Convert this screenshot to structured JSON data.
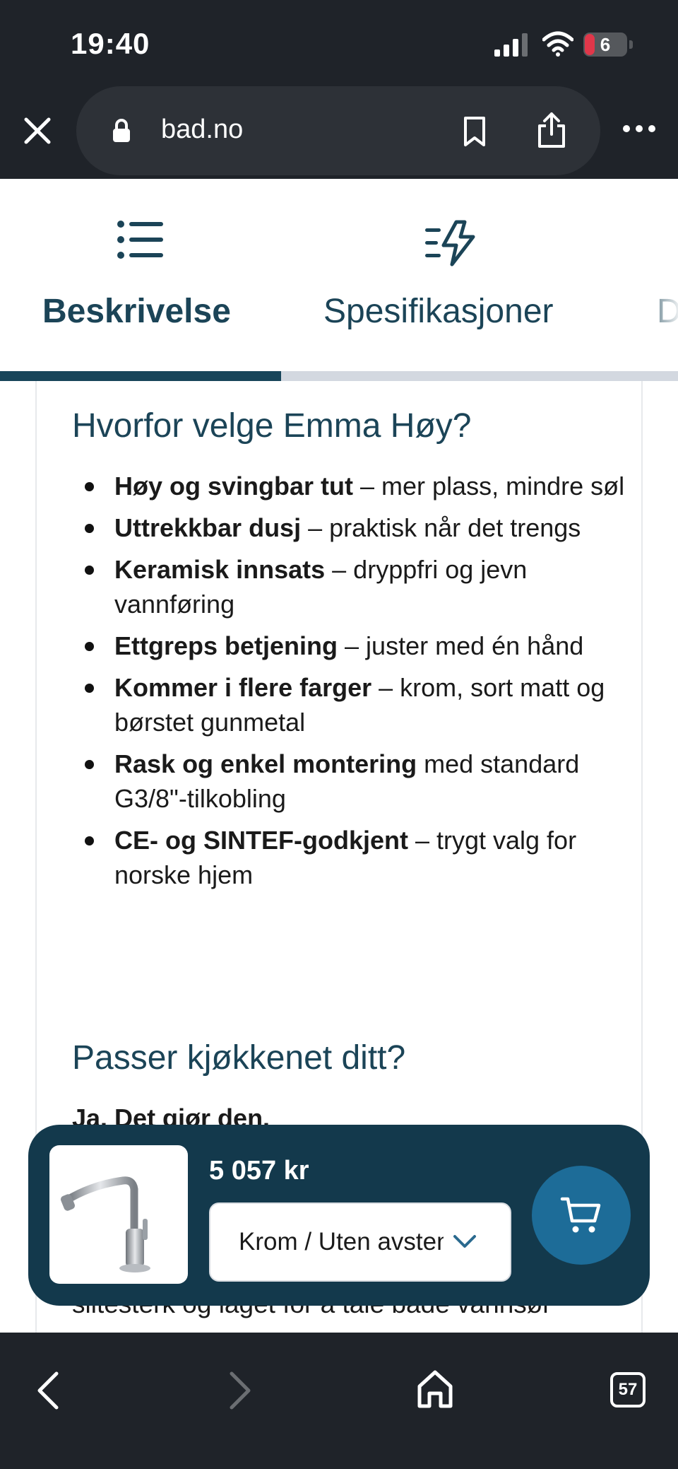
{
  "status_bar": {
    "time": "19:40",
    "battery": "6"
  },
  "browser": {
    "url": "bad.no"
  },
  "tabs": [
    {
      "label": "Beskrivelse",
      "icon": "list-icon",
      "active": true
    },
    {
      "label": "Spesifikasjoner",
      "icon": "lightning-lines-icon",
      "active": false
    },
    {
      "label": "D",
      "active": false
    }
  ],
  "content": {
    "why_heading": "Hvorfor velge Emma Høy?",
    "features": [
      {
        "bold": "Høy og svingbar tut",
        "text": " – mer plass, mindre søl"
      },
      {
        "bold": "Uttrekkbar dusj",
        "text": " – praktisk når det trengs"
      },
      {
        "bold": "Keramisk innsats",
        "text": " – dryppfri og jevn vannføring"
      },
      {
        "bold": "Ettgreps betjening",
        "text": " – juster med én hånd"
      },
      {
        "bold": "Kommer i flere farger",
        "text": " – krom, sort matt og børstet gunmetal"
      },
      {
        "bold": "Rask og enkel montering",
        "text": " med standard G3/8\"-tilkobling"
      },
      {
        "bold": "CE- og SINTEF-godkjent",
        "text": " – trygt valg for norske hjem"
      }
    ],
    "fit_heading": "Passer kjøkkenet ditt?",
    "fit_answer": "Ja. Det gjør den.",
    "body_line": "slitesterk og laget for å tåle både vannsøl"
  },
  "buy_bar": {
    "price": "5 057 kr",
    "variant": "Krom / Uten avstengning",
    "product_image": "kitchen-faucet-chrome"
  },
  "bottom_bar": {
    "tab_count": "57"
  },
  "colors": {
    "brand_dark": "#13394c",
    "heading": "#1b4457",
    "cart_button": "#1d6c98",
    "chrome_bg": "#1f2329"
  }
}
